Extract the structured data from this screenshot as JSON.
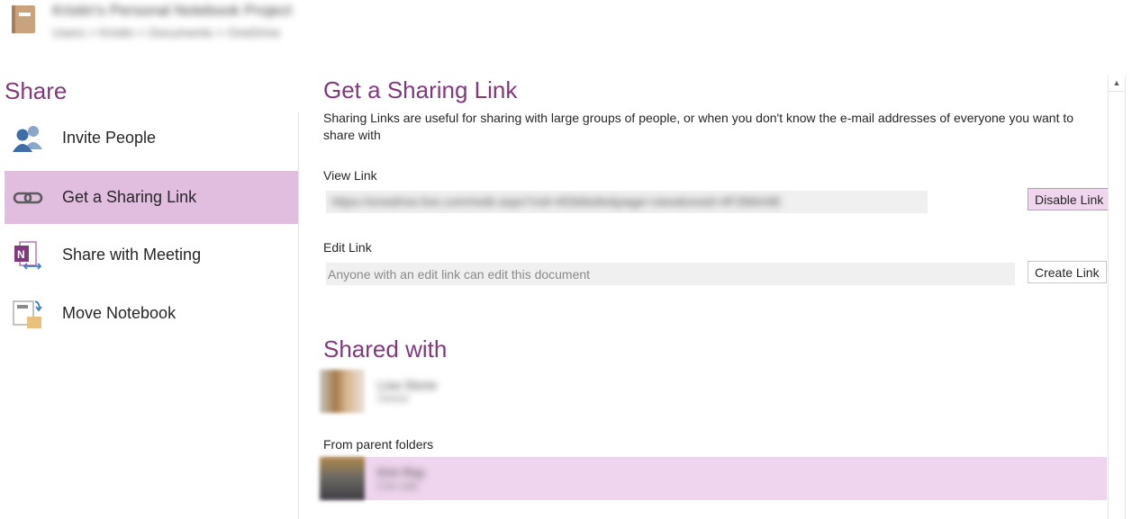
{
  "notebook": {
    "title": "Kristin's Personal Notebook Project",
    "path": "Users > Kristin > Documents > OneDrive",
    "icon": "notebook-icon"
  },
  "sidebar": {
    "heading": "Share",
    "items": [
      {
        "label": "Invite People",
        "icon": "invite-people-icon",
        "selected": false
      },
      {
        "label": "Get a Sharing Link",
        "icon": "link-icon",
        "selected": true
      },
      {
        "label": "Share with Meeting",
        "icon": "onenote-meeting-icon",
        "selected": false
      },
      {
        "label": "Move Notebook",
        "icon": "move-notebook-icon",
        "selected": false
      }
    ]
  },
  "main": {
    "heading": "Get a Sharing Link",
    "description": "Sharing Links are useful for sharing with large groups of people, or when you don't know the e-mail addresses of everyone you want to share with",
    "view_link": {
      "label": "View Link",
      "value": "https://onedrive.live.com/redir.aspx?cid=4f2b8a9e&page=view&resid=4F2B8A9E",
      "button": "Disable Link"
    },
    "edit_link": {
      "label": "Edit Link",
      "placeholder": "Anyone with an edit link can edit this document",
      "button": "Create Link"
    },
    "shared_with": {
      "heading": "Shared with",
      "people": [
        {
          "name": "Lisa Stone",
          "role": "Owner"
        }
      ],
      "parent_label": "From parent folders",
      "parent_people": [
        {
          "name": "Kim Ray",
          "role": "Can edit"
        }
      ]
    }
  },
  "colors": {
    "accent": "#80397b",
    "selected_bg": "#e1bee0",
    "row_highlight": "#efd5ee"
  }
}
